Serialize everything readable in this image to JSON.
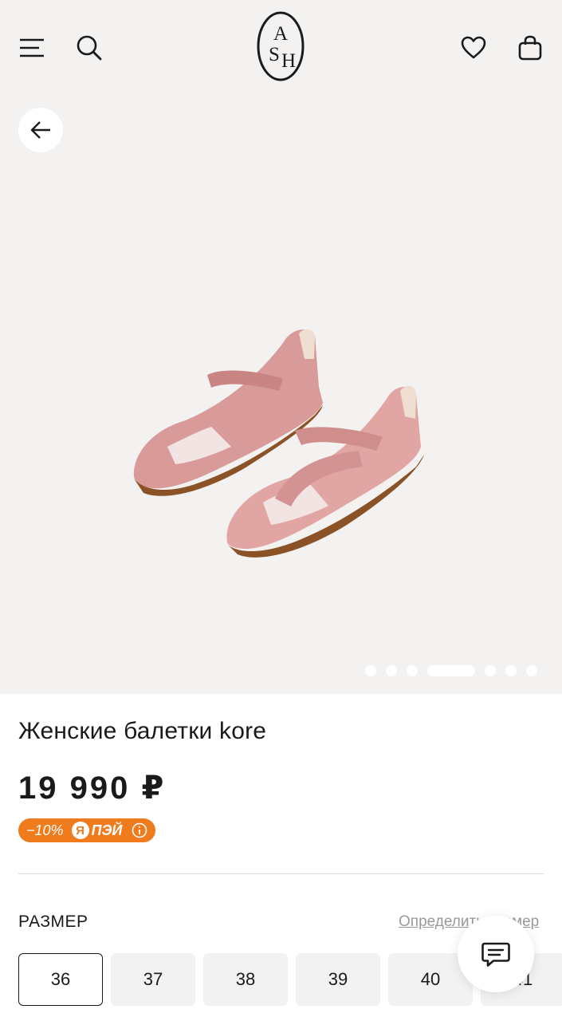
{
  "header": {
    "logo_text": "ASH",
    "icons": [
      "menu-icon",
      "search-icon",
      "heart-icon",
      "shopping-bag-icon"
    ]
  },
  "gallery": {
    "back_icon": "arrow-left-icon",
    "image_alt": "Женские балетки kore",
    "slides_total": 7,
    "active_slide": 4
  },
  "product": {
    "title": "Женские балетки kore",
    "price": "19 990 ₽"
  },
  "promo": {
    "discount": "−10%",
    "ya_letter": "Я",
    "pay_text": "ПЭЙ",
    "info_icon": "info-icon",
    "color": "#f07b1d"
  },
  "size_section": {
    "label": "РАЗМЕР",
    "guide_link": "Определить размер",
    "sizes": [
      "36",
      "37",
      "38",
      "39",
      "40",
      "41"
    ],
    "selected": "36"
  },
  "chat": {
    "icon": "chat-icon"
  }
}
